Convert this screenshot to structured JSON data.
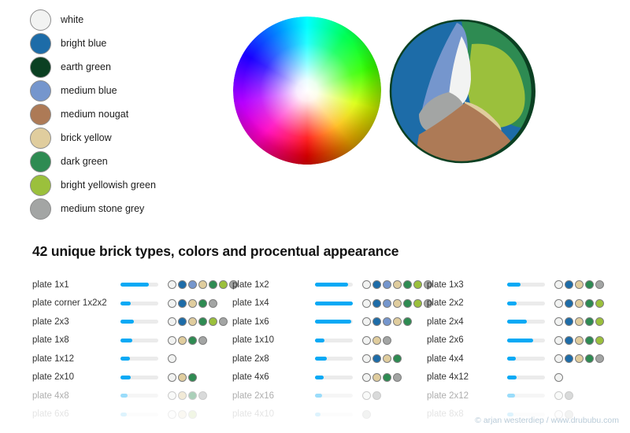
{
  "legend": {
    "items": [
      {
        "label": "white",
        "color": "#f2f3f2"
      },
      {
        "label": "bright blue",
        "color": "#1d6ca8"
      },
      {
        "label": "earth green",
        "color": "#0b4022"
      },
      {
        "label": "medium blue",
        "color": "#7596cd"
      },
      {
        "label": "medium nougat",
        "color": "#ad7a56"
      },
      {
        "label": "brick yellow",
        "color": "#e0cd9e"
      },
      {
        "label": "dark green",
        "color": "#2e8b52"
      },
      {
        "label": "bright yellowish green",
        "color": "#9bc03c"
      },
      {
        "label": "medium stone grey",
        "color": "#a3a5a4"
      }
    ]
  },
  "spheres": {
    "color_wheel": {
      "name": "hsv-color-wheel-sphere",
      "center_color": "#ffffff",
      "hues": [
        "#00ffff",
        "#35ff00",
        "#d9ff00",
        "#ff0000",
        "#ff00c0",
        "#1a00ff"
      ]
    },
    "lego_sphere": {
      "name": "quantized-lego-color-sphere",
      "rim_color": "#0b4022",
      "region_colors": [
        "#1d6ca8",
        "#7596cd",
        "#f2f3f2",
        "#a3a5a4",
        "#ad7a56",
        "#e0cd9e",
        "#9bc03c",
        "#2e8b52",
        "#0b4022"
      ]
    }
  },
  "title": "42 unique brick types, colors and procentual appearance",
  "copyright": "© arjan westerdiep / www.drububu.com",
  "chart_data": {
    "type": "bar",
    "title": "42 unique brick types, colors and procentual appearance",
    "xlabel": "",
    "ylabel": "",
    "columns": [
      {
        "rows": [
          {
            "name": "plate 1x1",
            "value": 38,
            "fade": 0,
            "colors": [
              "#f2f3f2",
              "#1d6ca8",
              "#7596cd",
              "#e0cd9e",
              "#2e8b52",
              "#9bc03c",
              "#a3a5a4"
            ]
          },
          {
            "name": "plate corner 1x2x2",
            "value": 14,
            "fade": 0,
            "colors": [
              "#f2f3f2",
              "#1d6ca8",
              "#e0cd9e",
              "#2e8b52",
              "#a3a5a4"
            ]
          },
          {
            "name": "plate 2x3",
            "value": 18,
            "fade": 0,
            "colors": [
              "#f2f3f2",
              "#1d6ca8",
              "#e0cd9e",
              "#2e8b52",
              "#9bc03c",
              "#a3a5a4"
            ]
          },
          {
            "name": "plate 1x8",
            "value": 16,
            "fade": 0,
            "colors": [
              "#f2f3f2",
              "#e0cd9e",
              "#2e8b52",
              "#a3a5a4"
            ]
          },
          {
            "name": "plate 1x12",
            "value": 12,
            "fade": 0,
            "colors": [
              "#f2f3f2"
            ]
          },
          {
            "name": "plate 2x10",
            "value": 14,
            "fade": 0,
            "colors": [
              "#f2f3f2",
              "#e0cd9e",
              "#2e8b52"
            ]
          },
          {
            "name": "plate 4x8",
            "value": 9,
            "fade": 1,
            "colors": [
              "#f2f3f2",
              "#e0cd9e",
              "#2e8b52",
              "#a3a5a4"
            ]
          },
          {
            "name": "plate 6x6",
            "value": 8,
            "fade": 2,
            "colors": [
              "#f2f3f2",
              "#e0cd9e",
              "#9bc03c"
            ]
          }
        ]
      },
      {
        "rows": [
          {
            "name": "plate 1x2",
            "value": 44,
            "fade": 0,
            "colors": [
              "#f2f3f2",
              "#1d6ca8",
              "#7596cd",
              "#e0cd9e",
              "#2e8b52",
              "#9bc03c",
              "#a3a5a4"
            ]
          },
          {
            "name": "plate 1x4",
            "value": 50,
            "fade": 0,
            "colors": [
              "#f2f3f2",
              "#1d6ca8",
              "#7596cd",
              "#e0cd9e",
              "#2e8b52",
              "#9bc03c",
              "#a3a5a4"
            ]
          },
          {
            "name": "plate 1x6",
            "value": 48,
            "fade": 0,
            "colors": [
              "#f2f3f2",
              "#1d6ca8",
              "#7596cd",
              "#e0cd9e",
              "#2e8b52"
            ]
          },
          {
            "name": "plate 1x10",
            "value": 13,
            "fade": 0,
            "colors": [
              "#f2f3f2",
              "#e0cd9e",
              "#a3a5a4"
            ]
          },
          {
            "name": "plate 2x8",
            "value": 16,
            "fade": 0,
            "colors": [
              "#f2f3f2",
              "#1d6ca8",
              "#e0cd9e",
              "#2e8b52"
            ]
          },
          {
            "name": "plate 4x6",
            "value": 11,
            "fade": 0,
            "colors": [
              "#f2f3f2",
              "#e0cd9e",
              "#2e8b52",
              "#a3a5a4"
            ]
          },
          {
            "name": "plate 2x16",
            "value": 9,
            "fade": 1,
            "colors": [
              "#f2f3f2",
              "#a3a5a4"
            ]
          },
          {
            "name": "plate 4x10",
            "value": 7,
            "fade": 2,
            "colors": [
              "#a3a5a4"
            ]
          }
        ]
      },
      {
        "rows": [
          {
            "name": "plate 1x3",
            "value": 18,
            "fade": 0,
            "colors": [
              "#f2f3f2",
              "#1d6ca8",
              "#e0cd9e",
              "#2e8b52",
              "#a3a5a4"
            ]
          },
          {
            "name": "plate 2x2",
            "value": 13,
            "fade": 0,
            "colors": [
              "#f2f3f2",
              "#1d6ca8",
              "#e0cd9e",
              "#2e8b52",
              "#9bc03c"
            ]
          },
          {
            "name": "plate 2x4",
            "value": 26,
            "fade": 0,
            "colors": [
              "#f2f3f2",
              "#1d6ca8",
              "#e0cd9e",
              "#2e8b52",
              "#9bc03c"
            ]
          },
          {
            "name": "plate 2x6",
            "value": 34,
            "fade": 0,
            "colors": [
              "#f2f3f2",
              "#1d6ca8",
              "#e0cd9e",
              "#2e8b52",
              "#9bc03c"
            ]
          },
          {
            "name": "plate 4x4",
            "value": 11,
            "fade": 0,
            "colors": [
              "#f2f3f2",
              "#1d6ca8",
              "#e0cd9e",
              "#2e8b52",
              "#a3a5a4"
            ]
          },
          {
            "name": "plate 4x12",
            "value": 13,
            "fade": 0,
            "colors": [
              "#f2f3f2"
            ]
          },
          {
            "name": "plate 2x12",
            "value": 10,
            "fade": 1,
            "colors": [
              "#f2f3f2",
              "#a3a5a4"
            ]
          },
          {
            "name": "plate 8x8",
            "value": 8,
            "fade": 2,
            "colors": [
              "#f2f3f2",
              "#a3a5a4"
            ]
          }
        ]
      }
    ]
  }
}
